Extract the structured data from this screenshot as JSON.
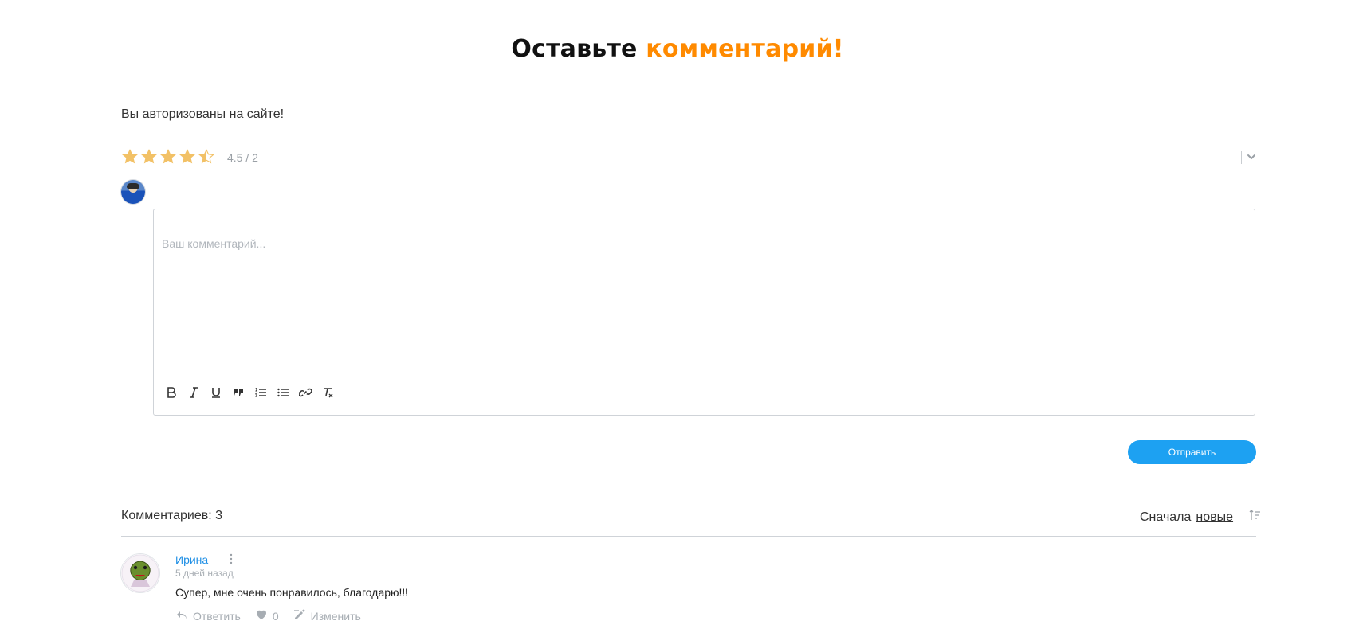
{
  "title": {
    "prefix": "Оставьте",
    "accent": "комментарий!"
  },
  "auth_message": "Вы авторизованы на сайте!",
  "rating": {
    "value": 4.5,
    "max": 5,
    "display": "4.5 / 2"
  },
  "editor": {
    "placeholder": "Ваш комментарий..."
  },
  "toolbar": [
    "bold-icon",
    "italic-icon",
    "underline-icon",
    "quote-icon",
    "ordered-list-icon",
    "bullet-list-icon",
    "link-icon",
    "clear-format-icon"
  ],
  "submit_label": "Отправить",
  "comments": {
    "count_label": "Комментариев: 3",
    "sort_prefix": "Сначала",
    "sort_value": "новые",
    "items": [
      {
        "author": "Ирина",
        "time": "5 дней назад",
        "text": "Супер, мне очень понравилось, благодарю!!!",
        "reply_label": "Ответить",
        "likes": "0",
        "edit_label": "Изменить"
      }
    ]
  },
  "colors": {
    "accent": "#ff8a00",
    "link": "#1f8fe5",
    "button": "#1da1f2",
    "star": "#f2c166"
  }
}
